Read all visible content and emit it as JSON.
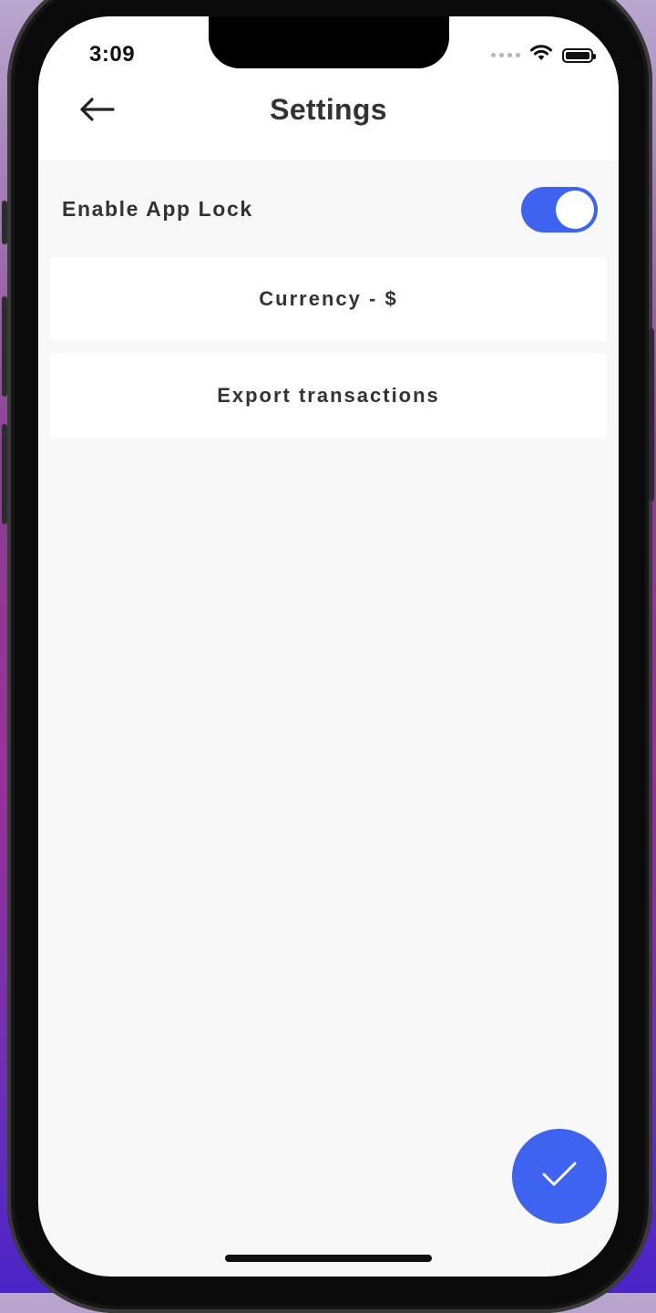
{
  "status_bar": {
    "time": "3:09",
    "icons": [
      "cellular-dots-icon",
      "wifi-icon",
      "battery-icon"
    ]
  },
  "header": {
    "back_icon": "arrow-left-icon",
    "title": "Settings"
  },
  "settings": {
    "app_lock": {
      "label": "Enable App Lock",
      "enabled": true
    },
    "items": [
      {
        "label": "Currency - $"
      },
      {
        "label": "Export transactions"
      }
    ]
  },
  "fab": {
    "icon": "checkmark-icon"
  },
  "colors": {
    "accent": "#3d63f0",
    "background": "#f8f8f8",
    "card": "#ffffff",
    "text": "#333333"
  }
}
